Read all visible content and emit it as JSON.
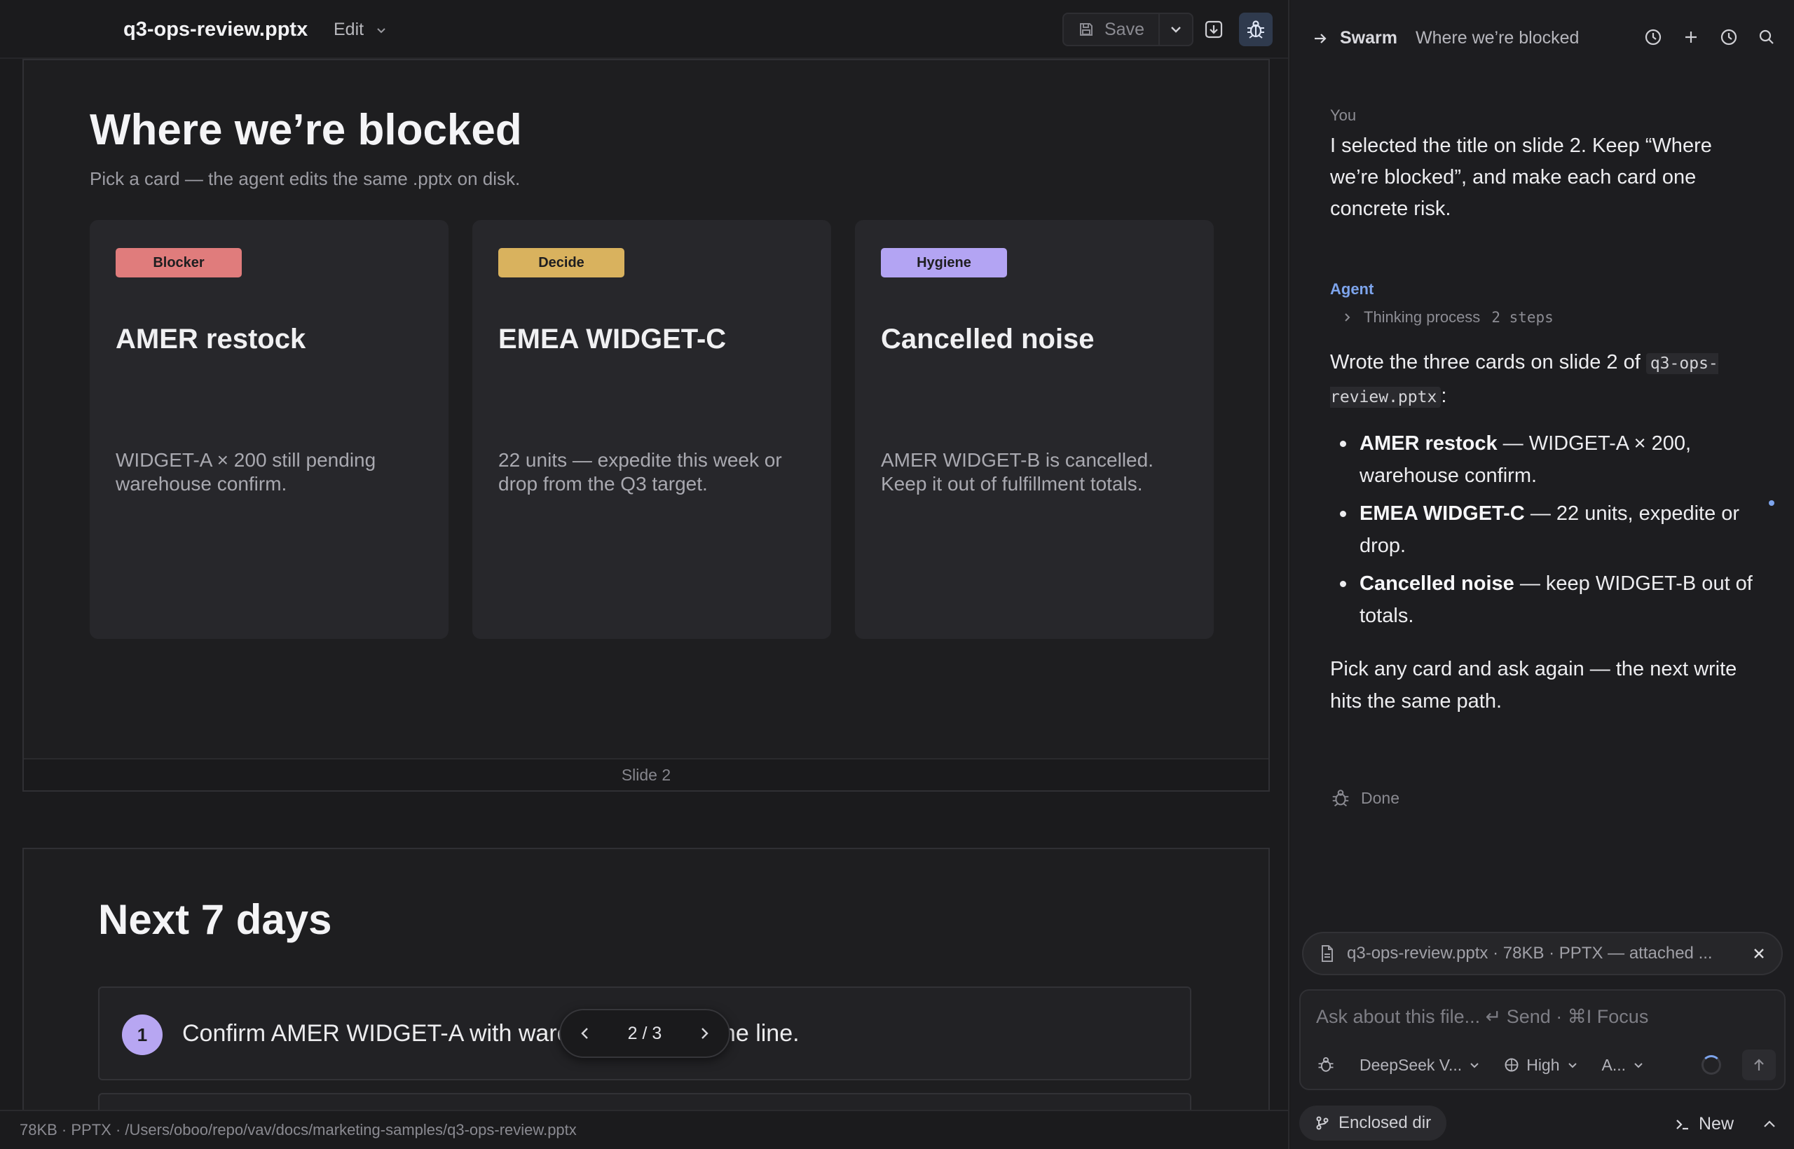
{
  "editor": {
    "filename": "q3-ops-review.pptx",
    "edit_label": "Edit",
    "save_label": "Save"
  },
  "slide1": {
    "title": "Where we’re blocked",
    "subtitle": "Pick a card — the agent edits the same .pptx on disk.",
    "footer": "Slide 2",
    "cards": [
      {
        "badge": "Blocker",
        "badge_color": "#e07c7c",
        "title": "AMER restock",
        "body": "WIDGET-A × 200 still pending warehouse confirm."
      },
      {
        "badge": "Decide",
        "badge_color": "#d9b25e",
        "title": "EMEA WIDGET-C",
        "body": "22 units — expedite this week or drop from the Q3 target."
      },
      {
        "badge": "Hygiene",
        "badge_color": "#b3a4f3",
        "title": "Cancelled noise",
        "body": "AMER WIDGET-B is cancelled. Keep it out of fulfillment totals."
      }
    ]
  },
  "slide2": {
    "title": "Next 7 days",
    "tasks": [
      {
        "num": "1",
        "text": "Confirm AMER WIDGET-A with warehouse before the line."
      }
    ]
  },
  "pager": {
    "label": "2 / 3"
  },
  "statusbar": {
    "text": "78KB · PPTX · /Users/oboo/repo/vav/docs/marketing-samples/q3-ops-review.pptx"
  },
  "chat": {
    "brand": "Swarm",
    "thread_title": "Where we’re blocked",
    "you_label": "You",
    "user_message": "I selected the title on slide 2. Keep “Where we’re blocked”, and make each card one concrete risk.",
    "agent_label": "Agent",
    "thinking_label": "Thinking process",
    "thinking_steps": "2 steps",
    "intro_prefix": "Wrote the three cards on slide 2 of",
    "intro_code": "q3-ops-review.pptx",
    "intro_suffix": ":",
    "bullets": [
      {
        "bold": "AMER restock",
        "rest": " — WIDGET-A × 200, warehouse confirm."
      },
      {
        "bold": "EMEA WIDGET-C",
        "rest": " — 22 units, expedite or drop."
      },
      {
        "bold": "Cancelled noise",
        "rest": " — keep WIDGET-B out of totals."
      }
    ],
    "outro": "Pick any card and ask again — the next write hits the same path.",
    "status": "Done",
    "attachment": "q3-ops-review.pptx · 78KB · PPTX — attached ...",
    "composer_placeholder": "Ask about this file... ↵ Send · ⌘I Focus",
    "model": "DeepSeek V...",
    "effort": "High",
    "mode": "A...",
    "dir_chip": "Enclosed dir",
    "new_label": "New"
  },
  "colors": {
    "accent": "#7da4ec",
    "active_bg": "#2f3a4d"
  }
}
